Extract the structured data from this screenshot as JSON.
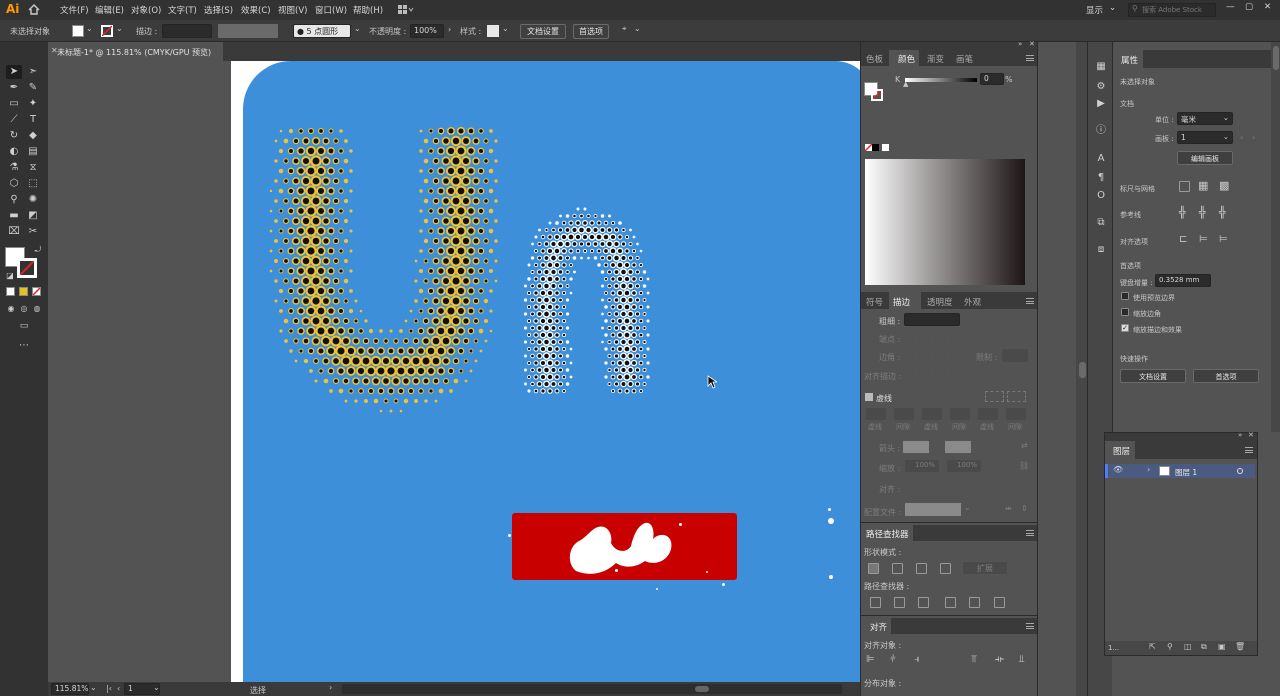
{
  "app": {
    "logo": "Ai"
  },
  "menu": {
    "items": [
      "文件(F)",
      "编辑(E)",
      "对象(O)",
      "文字(T)",
      "选择(S)",
      "效果(C)",
      "视图(V)",
      "窗口(W)",
      "帮助(H)"
    ],
    "workspace": "显示",
    "search_placeholder": "搜索 Adobe Stock"
  },
  "control": {
    "no_selection": "未选择对象",
    "stroke_label": "描边 :",
    "brush": "5 点圆形",
    "opacity_label": "不透明度 :",
    "opacity_value": "100%",
    "style_label": "样式 :",
    "doc_setup": "文档设置",
    "prefs": "首选项"
  },
  "document": {
    "tab": "未标题-1* @ 115.81% (CMYK/GPU 预览)"
  },
  "status": {
    "zoom": "115.81%",
    "artboard": "1",
    "tool": "选择"
  },
  "color_panel": {
    "tabs": [
      "色板",
      "颜色",
      "渐变",
      "画笔"
    ],
    "channel": "K",
    "value": "0",
    "unit": "%"
  },
  "stroke_panel": {
    "tabs": [
      "符号",
      "描边",
      "透明度",
      "外观"
    ],
    "weight_label": "粗细 :",
    "cap_label": "端点 :",
    "corner_label": "边角 :",
    "limit_label": "限制 :",
    "align_label": "对齐描边 :",
    "dashed_label": "虚线",
    "dash_labels": [
      "虚线",
      "间隙",
      "虚线",
      "间隙",
      "虚线",
      "间隙"
    ],
    "arrow_label": "箭头 :",
    "scale_label": "缩放 :",
    "scale_values": [
      "100%",
      "100%"
    ],
    "align_arrow_label": "对齐 :",
    "profile_label": "配置文件 :"
  },
  "pathfinder": {
    "title": "路径查找器",
    "shape_modes": "形状模式 :",
    "expand": "扩展",
    "pathfinders": "路径查找器 :"
  },
  "align_panel": {
    "title": "对齐",
    "align_objects": "对齐对象 :",
    "distribute": "分布对象 :"
  },
  "properties": {
    "title": "属性",
    "no_selection": "未选择对象",
    "document": "文档",
    "units_label": "单位 :",
    "units_value": "毫米",
    "artboard_label": "画板 :",
    "artboard_value": "1",
    "edit_artboards": "编辑画板",
    "rulers_grids": "标尺与网格",
    "guides": "参考线",
    "snap": "对齐选项",
    "preferences": "首选项",
    "keyboard_increment": "键盘增量 :",
    "increment_value": "0.3528 mm",
    "opt_preview_bounds": "使用预览边界",
    "opt_scale_corners": "缩放边角",
    "opt_scale_strokes": "缩放描边和效果",
    "quick_actions": "快速操作",
    "doc_setup": "文档设置",
    "prefs": "首选项"
  },
  "layers_panel": {
    "title": "图层",
    "layer_name": "图层 1",
    "count": "1..."
  },
  "canvas": {
    "artboard_color": "#3d8fda",
    "yellow": "#f2c230",
    "red": "#c90000"
  }
}
